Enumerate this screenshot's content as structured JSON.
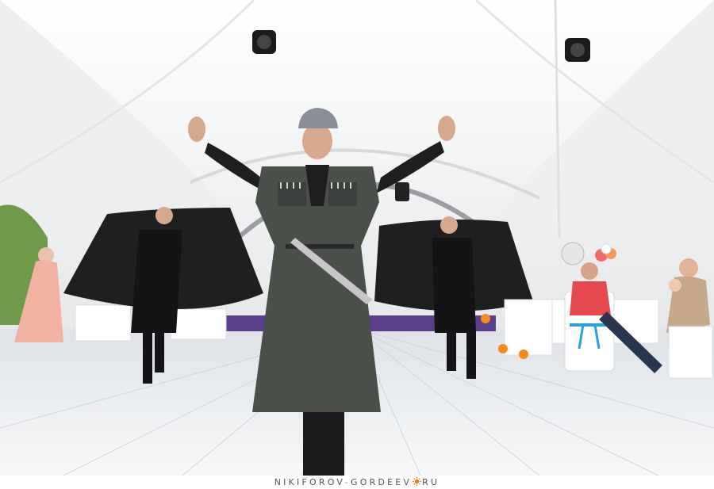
{
  "photo": {
    "colors": {
      "tent": "#f3f3f3",
      "floor": "#eceef0",
      "costume": "#4a4f4a",
      "cape": "#1f1f22",
      "dress": "#f1b2a2",
      "ribbon": "#2aa0d8",
      "stage": "#5b3f8a",
      "foliage": "#6f9a4a"
    }
  },
  "watermark": {
    "part1": "NIKIFOROV",
    "sep1": "-",
    "part2": "GORDEEV",
    "part3": "RU",
    "accent_color": "#e8801f",
    "icon": "sun-icon"
  }
}
